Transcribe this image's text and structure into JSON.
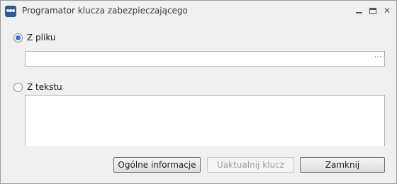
{
  "window": {
    "title": "Programator klucza zabezpieczającego",
    "controls": {
      "minimize_icon": "minimize-icon",
      "maximize_icon": "maximize-icon",
      "close_icon": "close-icon",
      "close_glyph": "✕"
    }
  },
  "source": {
    "file_option": {
      "label": "Z pliku",
      "checked": true
    },
    "file_path": {
      "value": "",
      "browse_label": "···"
    },
    "text_option": {
      "label": "Z tekstu",
      "checked": false
    },
    "text_content": {
      "value": ""
    }
  },
  "actions": {
    "info_label": "Ogólne informacje",
    "update_label": "Uaktualnij klucz",
    "update_enabled": false,
    "close_label": "Zamknij"
  },
  "colors": {
    "app_icon": "#2c5a91",
    "radio_selected": "#3570b9"
  }
}
